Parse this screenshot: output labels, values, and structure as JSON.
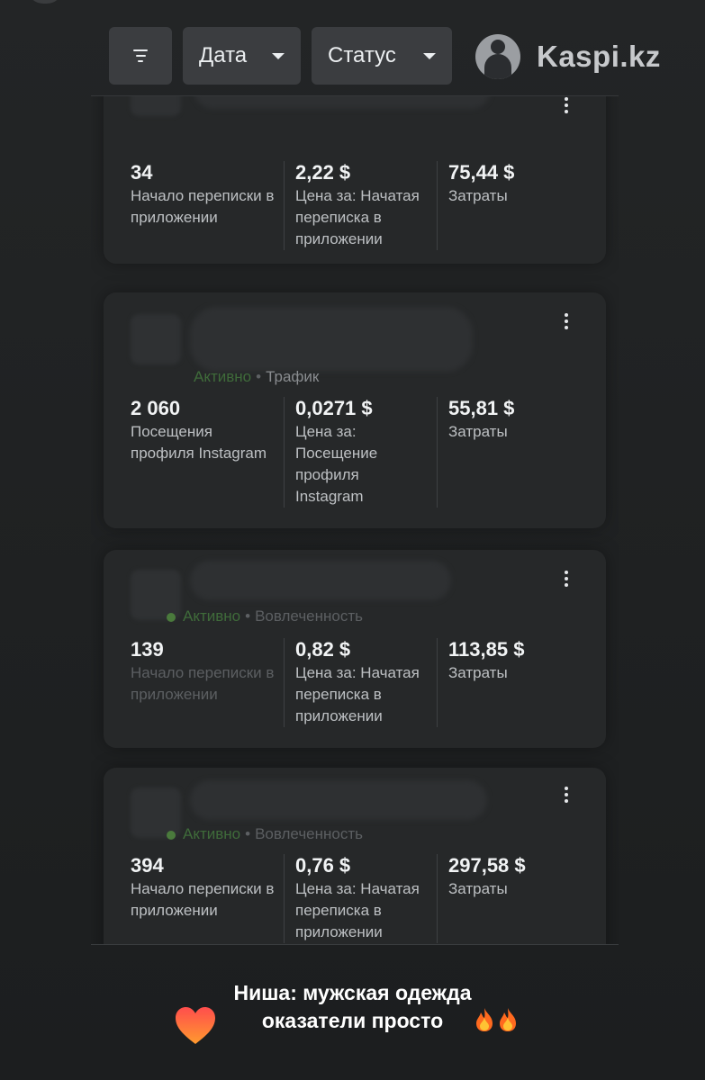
{
  "toolbar": {
    "filter_icon": "filter-icon",
    "date_label": "Дата",
    "status_label": "Статус"
  },
  "brand": {
    "name": "Kaspi.kz"
  },
  "cards": [
    {
      "status": "",
      "status_category": "",
      "metrics": [
        {
          "value": "34",
          "label": "Начало переписки в приложении"
        },
        {
          "value": "2,22 $",
          "label": "Цена за: Начатая переписка в приложении"
        },
        {
          "value": "75,44 $",
          "label": "Затраты"
        }
      ]
    },
    {
      "status": "Активно",
      "status_category": "Трафик",
      "metrics": [
        {
          "value": "2 060",
          "label": "Посещения профиля Instagram"
        },
        {
          "value": "0,0271 $",
          "label": "Цена за: Посещение профиля Instagram"
        },
        {
          "value": "55,81 $",
          "label": "Затраты"
        }
      ]
    },
    {
      "status": "Активно",
      "status_category": "Вовлеченность",
      "metrics": [
        {
          "value": "139",
          "label": "Начало переписки в приложении"
        },
        {
          "value": "0,82 $",
          "label": "Цена за: Начатая переписка в приложении"
        },
        {
          "value": "113,85 $",
          "label": "Затраты"
        }
      ]
    },
    {
      "status": "Активно",
      "status_category": "Вовлеченность",
      "metrics": [
        {
          "value": "394",
          "label": "Начало переписки в приложении"
        },
        {
          "value": "0,76 $",
          "label": "Цена за: Начатая переписка в приложении"
        },
        {
          "value": "297,58 $",
          "label": "Затраты"
        }
      ]
    }
  ],
  "caption": {
    "line1": "Ниша: мужская одежда",
    "line2": "оказатели просто",
    "emoji_heart": "heart-icon",
    "emoji_fire": "fire-icon"
  }
}
